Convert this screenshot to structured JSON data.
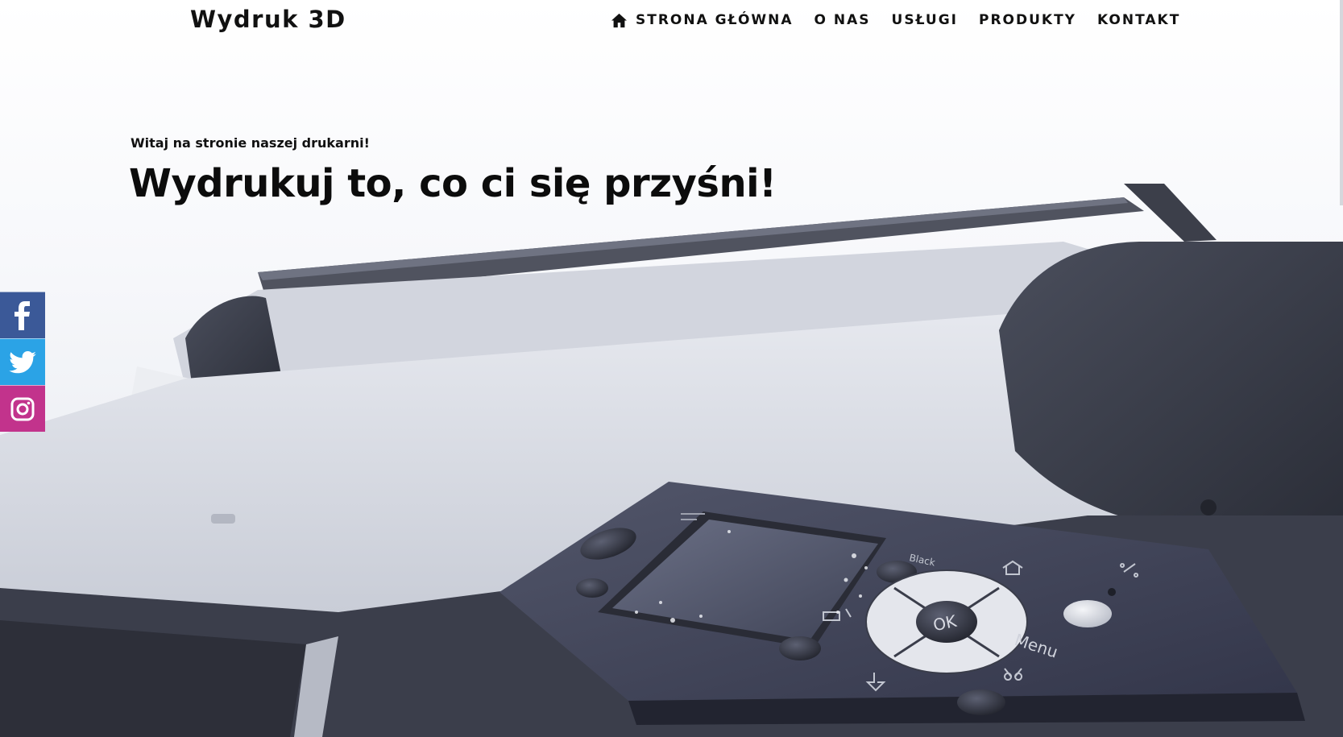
{
  "header": {
    "logo": "Wydruk 3D",
    "nav": [
      {
        "label": "STRONA GŁÓWNA",
        "icon": "home-icon"
      },
      {
        "label": "O NAS"
      },
      {
        "label": "USŁUGI"
      },
      {
        "label": "PRODUKTY"
      },
      {
        "label": "KONTAKT"
      }
    ]
  },
  "hero": {
    "subtitle": "Witaj na stronie naszej drukarni!",
    "title": "Wydrukuj to, co ci się przyśni!",
    "panel_labels": {
      "ok": "OK",
      "menu": "Menu",
      "black": "Black"
    }
  },
  "social": [
    {
      "name": "facebook",
      "icon": "facebook-icon",
      "color": "#3b5998"
    },
    {
      "name": "twitter",
      "icon": "twitter-icon",
      "color": "#2ba3e6"
    },
    {
      "name": "instagram",
      "icon": "instagram-icon",
      "color": "#c2338c"
    }
  ],
  "colors": {
    "text": "#111111",
    "printer_dark": "#3a3d4a",
    "printer_light": "#e6e8ee"
  }
}
